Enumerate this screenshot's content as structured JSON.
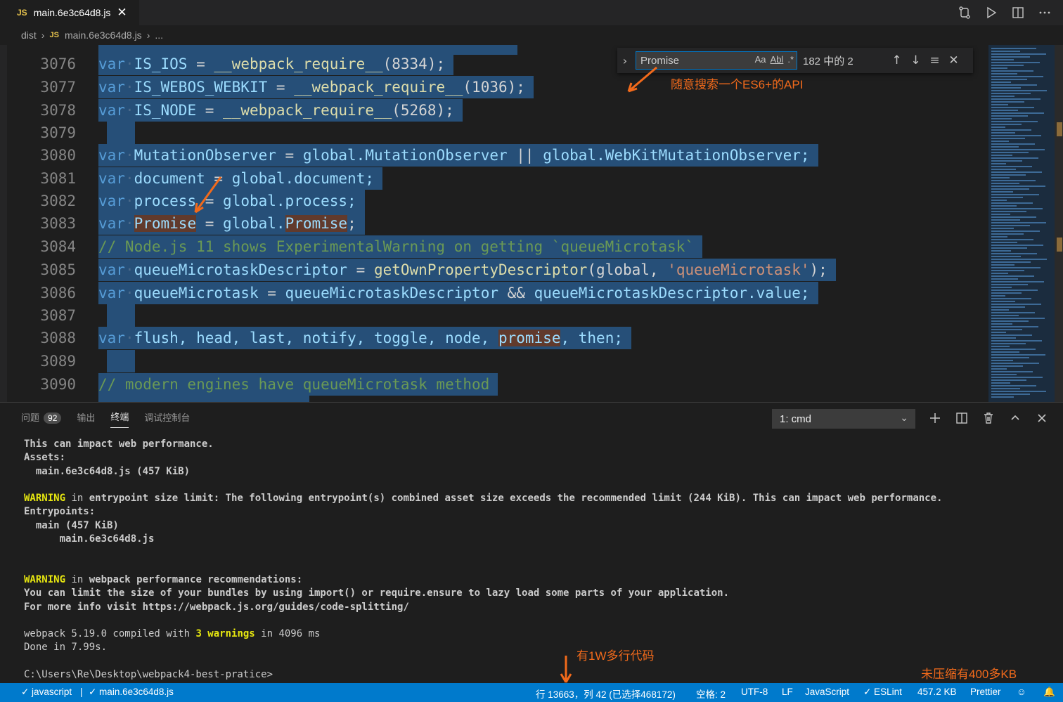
{
  "tab": {
    "lang_badge": "JS",
    "title": "main.6e3c64d8.js",
    "close": "✕"
  },
  "editor_actions": [
    "open-changes-icon",
    "run-icon",
    "split-editor-icon",
    "more-actions-icon"
  ],
  "breadcrumb": {
    "root": "dist",
    "lang_badge": "JS",
    "file": "main.6e3c64d8.js",
    "more": "..."
  },
  "find": {
    "query": "Promise",
    "opt_case": "Aa",
    "opt_word": "Abl",
    "opt_regex": ".*",
    "count": "182 中的 2"
  },
  "annotations": {
    "search_hint": "随意搜索一个ES6+的API",
    "lines_hint": "有1W多行代码",
    "size_hint": "未压缩有400多KB"
  },
  "code_lines": [
    {
      "num": "3076"
    },
    {
      "num": "3077"
    },
    {
      "num": "3078"
    },
    {
      "num": "3079"
    },
    {
      "num": "3080"
    },
    {
      "num": "3081"
    },
    {
      "num": "3082"
    },
    {
      "num": "3083"
    },
    {
      "num": "3084"
    },
    {
      "num": "3085"
    },
    {
      "num": "3086"
    },
    {
      "num": "3087"
    },
    {
      "num": "3088"
    },
    {
      "num": "3089"
    },
    {
      "num": "3090"
    }
  ],
  "code": {
    "kw_var": "var",
    "l3076": {
      "name": "IS_IOS",
      "call": "__webpack_require__",
      "arg": "(8334);"
    },
    "l3077": {
      "name": "IS_WEBOS_WEBKIT",
      "call": "__webpack_require__",
      "arg": "(1036);"
    },
    "l3078": {
      "name": "IS_NODE",
      "call": "__webpack_require__",
      "arg": "(5268);"
    },
    "l3080": {
      "name": "MutationObserver",
      "rhs1": "global.MutationObserver",
      "op": "||",
      "rhs2": "global.WebKitMutationObserver;"
    },
    "l3081": {
      "name": "document",
      "rhs": "global.document;"
    },
    "l3082": {
      "name": "process",
      "rhs": "global.process;"
    },
    "l3083": {
      "name": "Promise",
      "rhs_obj": "global.",
      "rhs_prop": "Promise",
      "end": ";"
    },
    "l3084": "// Node.js 11 shows ExperimentalWarning on getting `queueMicrotask`",
    "l3085": {
      "name": "queueMicrotaskDescriptor",
      "call": "getOwnPropertyDescriptor",
      "arg1": "(global, ",
      "str": "'queueMicrotask'",
      "end": ");"
    },
    "l3086": {
      "name": "queueMicrotask",
      "rhs1": "queueMicrotaskDescriptor",
      "op": "&&",
      "rhs2": "queueMicrotaskDescriptor.value;"
    },
    "l3088": {
      "vars": "flush, head, last, notify, toggle, node, ",
      "hl": "promise",
      "end": ", then;"
    },
    "l3090": "// modern engines have queueMicrotask method"
  },
  "panel": {
    "tabs": [
      {
        "label": "问题",
        "badge": "92"
      },
      {
        "label": "输出"
      },
      {
        "label": "终端"
      },
      {
        "label": "调试控制台"
      }
    ],
    "terminal_select": "1: cmd"
  },
  "terminal": {
    "l1": "This can impact web performance.",
    "l2": "Assets:",
    "l3": "  main.6e3c64d8.js (457 KiB)",
    "l5_warn": "WARNING",
    "l5_in": " in ",
    "l5_rest": "entrypoint size limit: The following entrypoint(s) combined asset size exceeds the recommended limit (244 KiB). This can impact web performance.",
    "l6": "Entrypoints:",
    "l7": "  main (457 KiB)",
    "l8": "      main.6e3c64d8.js",
    "l11_warn": "WARNING",
    "l11_in": " in ",
    "l11_rest": "webpack performance recommendations:",
    "l12": "You can limit the size of your bundles by using import() or require.ensure to lazy load some parts of your application.",
    "l13": "For more info visit https://webpack.js.org/guides/code-splitting/",
    "l15_a": "webpack 5.19.0 compiled with ",
    "l15_b": "3 warnings",
    "l15_c": " in 4096 ms",
    "l16": "Done in 7.99s.",
    "l18": "C:\\Users\\Re\\Desktop\\webpack4-best-pratice>"
  },
  "status": {
    "left1": "✓ javascript",
    "sep": "|",
    "left2": "✓ main.6e3c64d8.js",
    "position": "行 13663，列 42 (已选择468172)",
    "spaces": "空格: 2",
    "encoding": "UTF-8",
    "eol": "LF",
    "language": "JavaScript",
    "eslint": "✓ ESLint",
    "size": "457.2 KB",
    "prettier": "Prettier"
  },
  "colors": {
    "accent": "#007acc",
    "selection": "#264f78",
    "annotation": "#f26a1b",
    "match": "#613a2c"
  }
}
